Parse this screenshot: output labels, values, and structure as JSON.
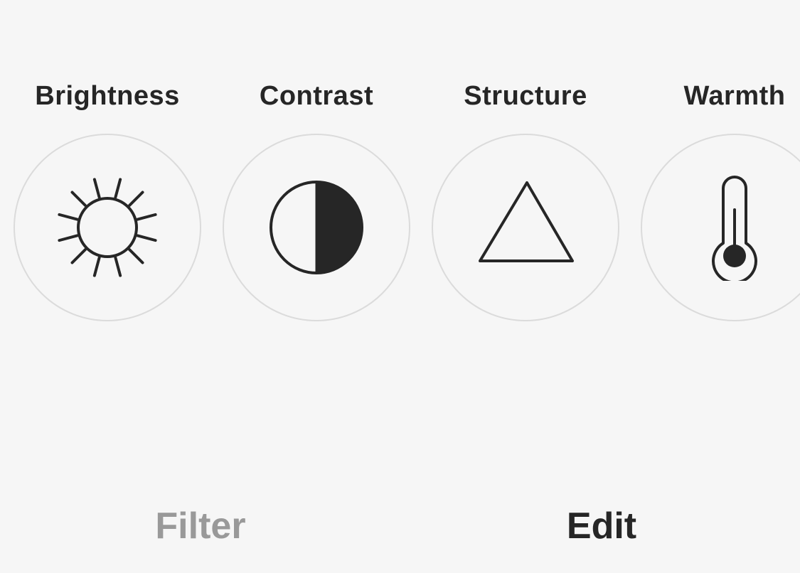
{
  "tools": [
    {
      "label": "Brightness",
      "icon": "sun-icon"
    },
    {
      "label": "Contrast",
      "icon": "half-circle-icon"
    },
    {
      "label": "Structure",
      "icon": "triangle-icon"
    },
    {
      "label": "Warmth",
      "icon": "thermometer-icon"
    }
  ],
  "tabs": {
    "filter_label": "Filter",
    "edit_label": "Edit",
    "active": "Edit"
  },
  "colors": {
    "background": "#f6f6f6",
    "foreground": "#262626",
    "inactive_tab": "#999999",
    "circle_border": "#dbdbdb"
  }
}
